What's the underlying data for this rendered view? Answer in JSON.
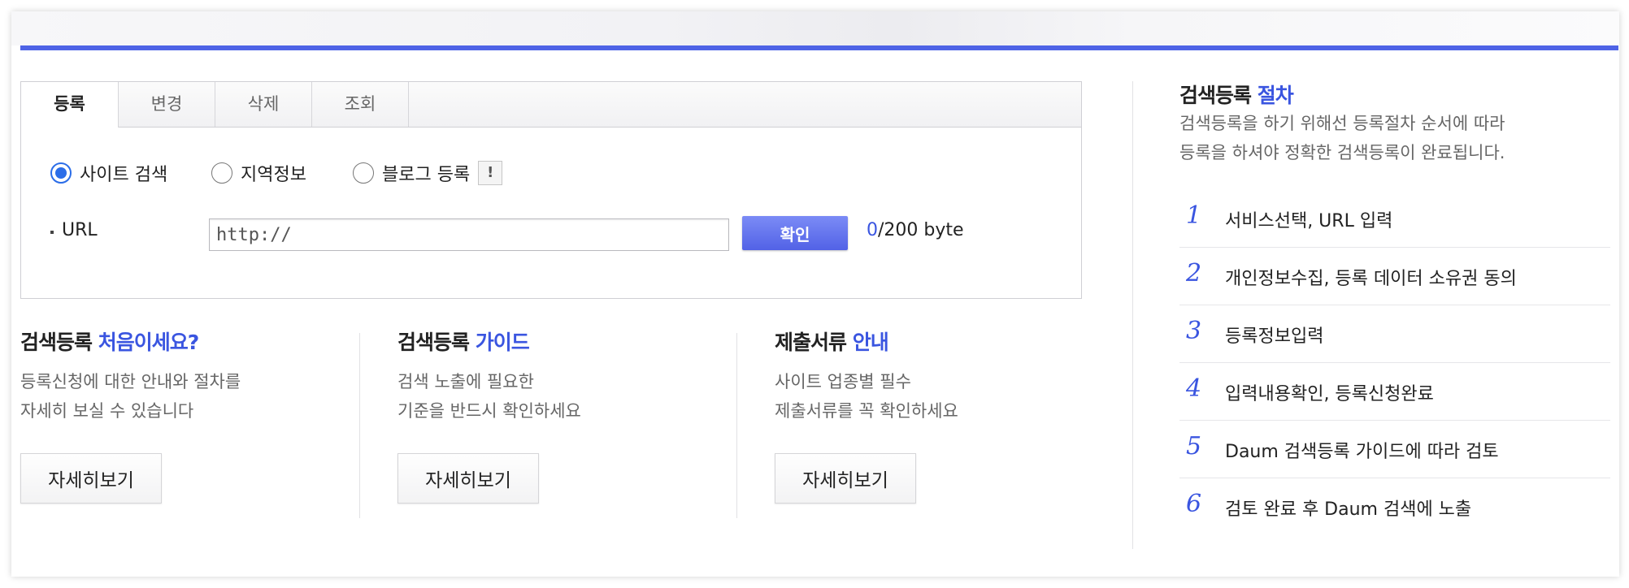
{
  "tabs": [
    "등록",
    "변경",
    "삭제",
    "조회"
  ],
  "radios": [
    {
      "label": "사이트 검색",
      "checked": true
    },
    {
      "label": "지역정보",
      "checked": false
    },
    {
      "label": "블로그 등록",
      "checked": false
    }
  ],
  "info_button": "!",
  "url": {
    "label": "URL",
    "value": "http://",
    "confirm_label": "확인",
    "byte_current": "0",
    "byte_max": "/200 byte"
  },
  "info_columns": [
    {
      "title": "검색등록",
      "accent": "처음이세요?",
      "desc1": "등록신청에 대한 안내와 절차를",
      "desc2": "자세히 보실 수 있습니다",
      "button": "자세히보기"
    },
    {
      "title": "검색등록",
      "accent": "가이드",
      "desc1": "검색 노출에 필요한",
      "desc2": "기준을 반드시 확인하세요",
      "button": "자세히보기"
    },
    {
      "title": "제출서류",
      "accent": "안내",
      "desc1": "사이트 업종별 필수",
      "desc2": "제출서류를 꼭 확인하세요",
      "button": "자세히보기"
    }
  ],
  "procedure": {
    "title": "검색등록",
    "accent": "절차",
    "desc1": "검색등록을 하기 위해선 등록절차 순서에 따라",
    "desc2": "등록을 하셔야 정확한 검색등록이 완료됩니다.",
    "steps": [
      {
        "num": "1",
        "text": "서비스선택, URL 입력"
      },
      {
        "num": "2",
        "text": "개인정보수집, 등록 데이터 소유권 동의"
      },
      {
        "num": "3",
        "text": "등록정보입력"
      },
      {
        "num": "4",
        "text": "입력내용확인, 등록신청완료"
      },
      {
        "num": "5",
        "text": "Daum 검색등록 가이드에 따라 검토"
      },
      {
        "num": "6",
        "text": "검토 완료 후 Daum 검색에 노출"
      }
    ]
  },
  "colors": {
    "accent": "#3a55e0",
    "bar": "#4e63e6",
    "radio_checked": "#2b6de8"
  }
}
